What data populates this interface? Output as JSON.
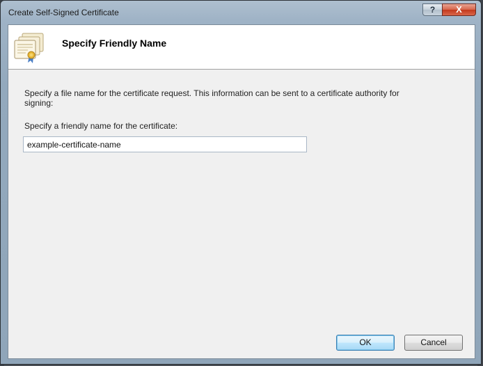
{
  "window": {
    "title": "Create Self-Signed Certificate",
    "help_label": "?",
    "close_label": "X"
  },
  "header": {
    "title": "Specify Friendly Name",
    "icon": "certificate-icon"
  },
  "main": {
    "description": "Specify a file name for the certificate request.  This information can be sent to a certificate authority for signing:",
    "field_label": "Specify a friendly name for the certificate:",
    "friendly_name_value": "example-certificate-name"
  },
  "buttons": {
    "ok_label": "OK",
    "cancel_label": "Cancel"
  }
}
